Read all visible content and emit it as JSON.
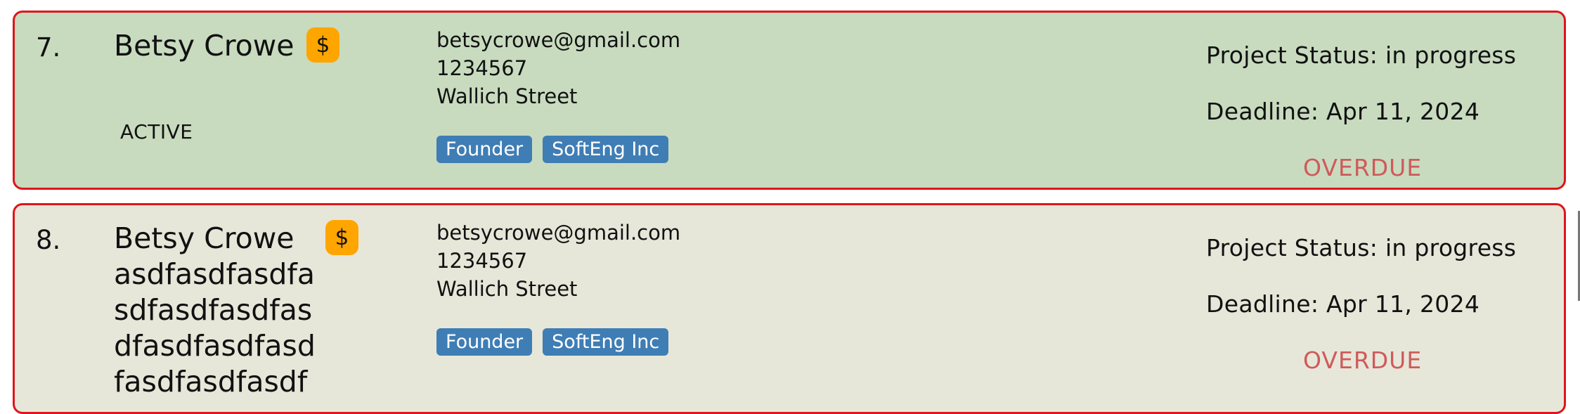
{
  "persons": [
    {
      "index": "7.",
      "name": "Betsy Crowe",
      "badge_symbol": "$",
      "status": "ACTIVE",
      "email": "betsycrowe@gmail.com",
      "phone": "1234567",
      "address": "Wallich Street",
      "tags": [
        "Founder",
        "SoftEng Inc"
      ],
      "project_status": "Project Status: in progress",
      "deadline": "Deadline: Apr 11, 2024",
      "overdue": "OVERDUE",
      "card_color": "#c8dbbf"
    },
    {
      "index": "8.",
      "name": "Betsy Crowe asdfasdfasdfa sdfasdfasdfas dfasdfasdfasd fasdfasdfasdf",
      "name_lines": [
        "Betsy Crowe",
        "asdfasdfasdfa",
        "sdfasdfasdfas",
        "dfasdfasdfasd",
        "fasdfasdfasdf"
      ],
      "badge_symbol": "$",
      "email": "betsycrowe@gmail.com",
      "phone": "1234567",
      "address": "Wallich Street",
      "tags": [
        "Founder",
        "SoftEng Inc"
      ],
      "project_status": "Project Status: in progress",
      "deadline": "Deadline: Apr 11, 2024",
      "overdue": "OVERDUE",
      "card_color": "#e6e7d9"
    }
  ],
  "colors": {
    "card_border": "#e0141c",
    "badge": "#ffa500",
    "tag": "#3f7db5",
    "overdue": "#cf5a5a"
  }
}
